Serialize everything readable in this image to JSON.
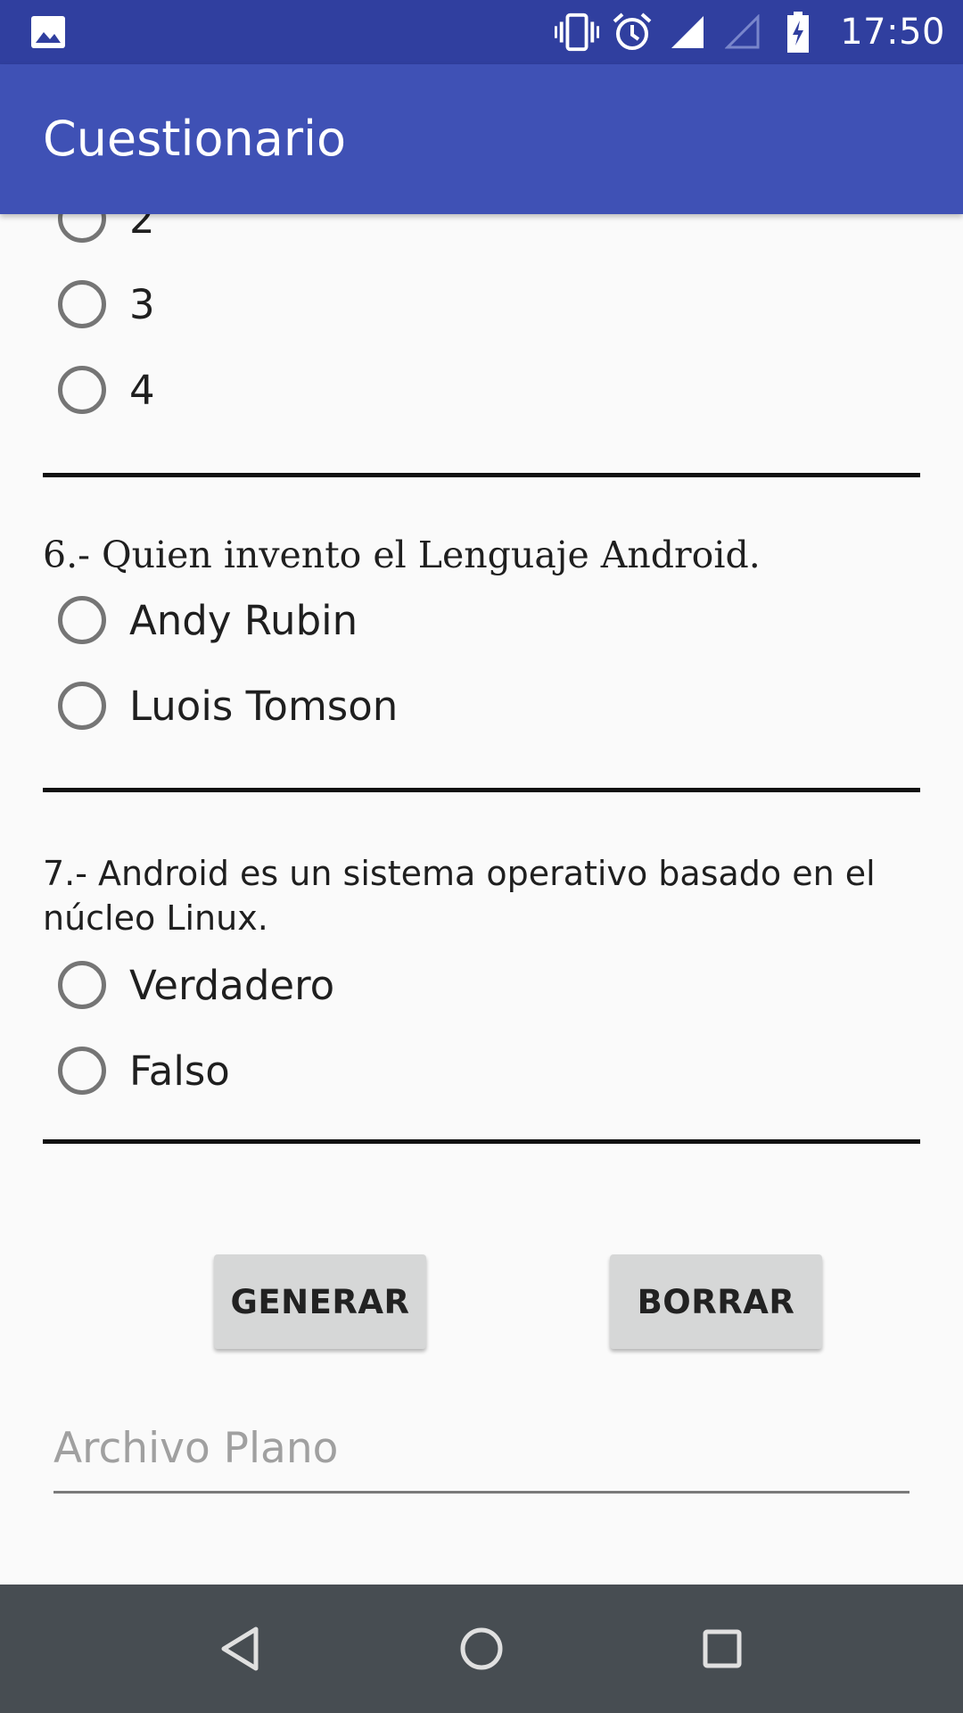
{
  "status_bar": {
    "time": "17:50",
    "icons": [
      "image-icon",
      "vibrate-icon",
      "alarm-icon",
      "signal-icon",
      "signal-empty-icon",
      "battery-charging-icon"
    ]
  },
  "app_bar": {
    "title": "Cuestionario"
  },
  "question5_partial": {
    "options": [
      "2",
      "3",
      "4"
    ]
  },
  "question6": {
    "text": "6.- Quien invento el Lenguaje Android.",
    "options": [
      "Andy Rubin",
      "Luois Tomson"
    ]
  },
  "question7": {
    "text": "7.- Android es un sistema operativo basado en el núcleo Linux.",
    "options": [
      "Verdadero",
      "Falso"
    ]
  },
  "buttons": {
    "generate": "GENERAR",
    "clear": "BORRAR"
  },
  "file_input": {
    "value": "",
    "placeholder": "Archivo Plano"
  },
  "nav_bar": {
    "icons": [
      "back-icon",
      "home-icon",
      "recents-icon"
    ]
  },
  "colors": {
    "status_bar": "#303f9f",
    "app_bar": "#3f51b5",
    "background": "#fafafa",
    "nav_bar": "#474d52"
  }
}
